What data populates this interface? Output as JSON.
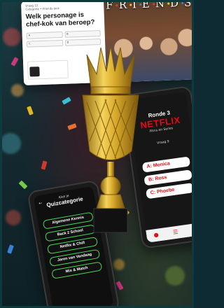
{
  "quiz_card": {
    "meta_line_1": "Vraag 12",
    "meta_line_2": "Categorie • Friends quiz",
    "question": "Welk personage is chef-kok van beroep?",
    "answers": [
      "A",
      "B",
      "C",
      "D"
    ],
    "show_title_letters": [
      "F",
      "R",
      "I",
      "E",
      "N",
      "D",
      "S"
    ],
    "dot_colors": [
      "#e63b2e",
      "#f6c624",
      "#2f8be0"
    ]
  },
  "phone_right": {
    "round_label": "Ronde 3",
    "brand": "NETFLIX",
    "subtitle": "Films en Series",
    "question_label": "Vraag 9",
    "question_text": "",
    "answers": [
      {
        "label": "A: Monica"
      },
      {
        "label": "B: Ross"
      },
      {
        "label": "C: Phoebe"
      }
    ],
    "bottom_icons": [
      "lightbulb-icon",
      "menu-icon",
      "chat-icon"
    ]
  },
  "phone_left": {
    "header_small": "Kies je",
    "header_title": "Quizcategorie",
    "categories": [
      "Algemene Kennis",
      "Back 2 School",
      "Netflix & Chill",
      "Jaren van Vandaag",
      "Mix & Match"
    ]
  },
  "colors": {
    "background": "#142a30",
    "netflix_red": "#e50914",
    "category_border": "#4ad65a",
    "trophy_gold": "#d6a829"
  }
}
